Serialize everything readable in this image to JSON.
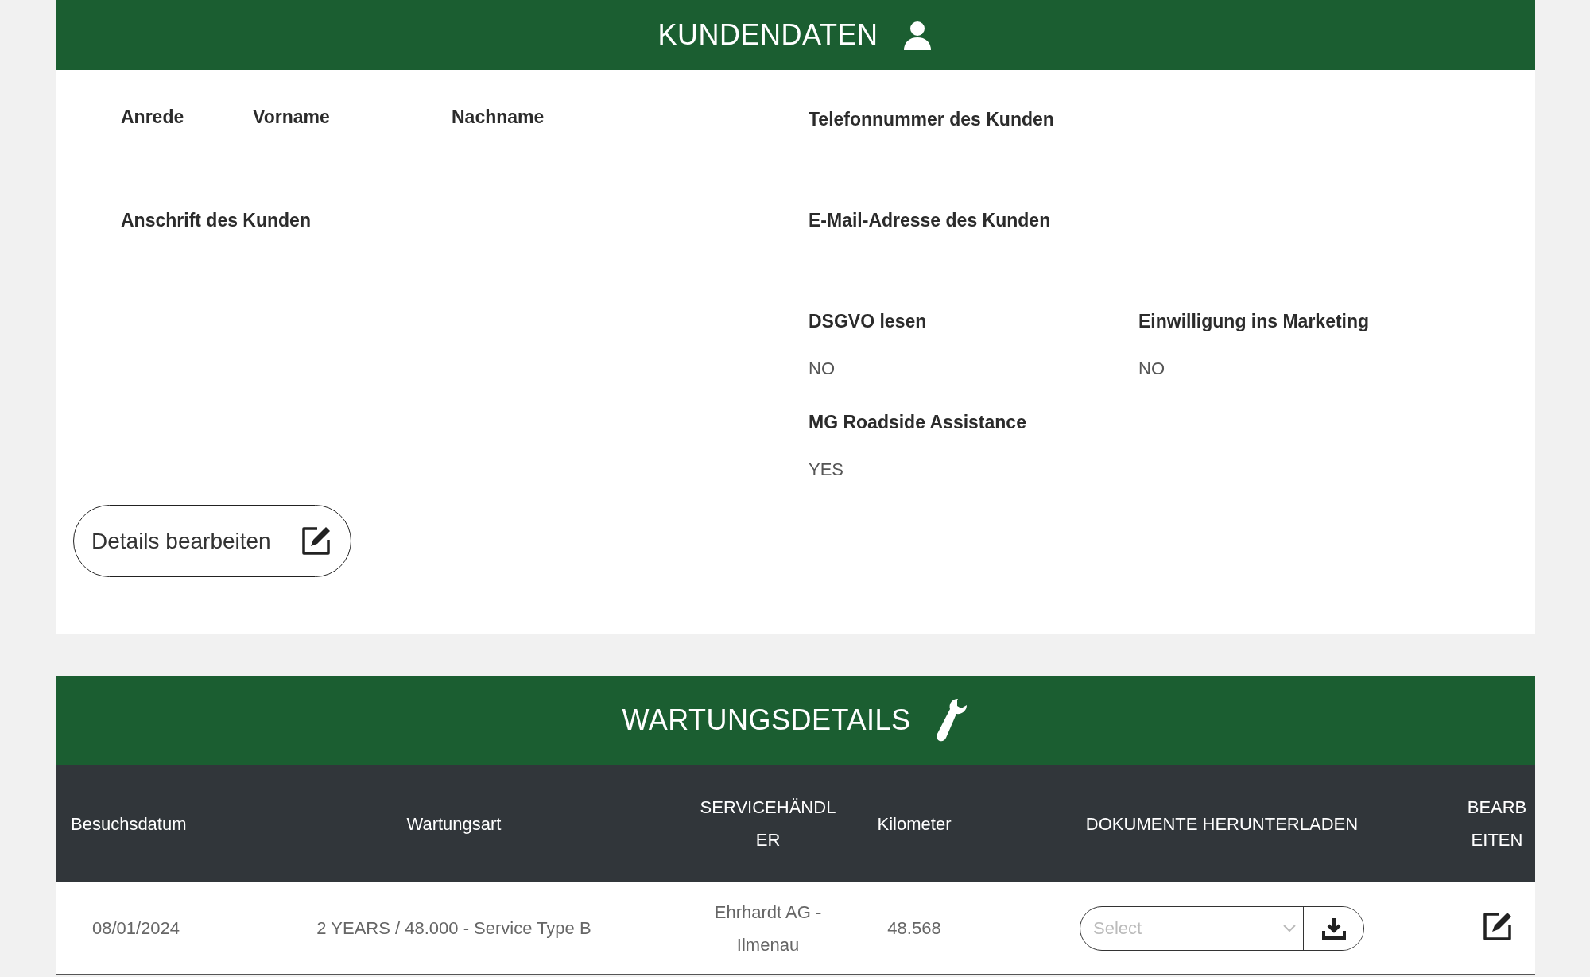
{
  "customer_section": {
    "title": "KUNDENDATEN",
    "name_fields": [
      "Anrede",
      "Vorname",
      "Nachname"
    ],
    "phone": {
      "label": "Telefonnummer des Kunden"
    },
    "address": {
      "label": "Anschrift des Kunden"
    },
    "email": {
      "label": "E-Mail-Adresse des Kunden"
    },
    "flags": [
      {
        "label": "DSGVO lesen",
        "value": "NO"
      },
      {
        "label": "Einwilligung ins Marketing",
        "value": "NO"
      },
      {
        "label": "MG Roadside Assistance",
        "value": "YES"
      }
    ],
    "edit_button": "Details bearbeiten"
  },
  "maintenance_section": {
    "title": "WARTUNGSDETAILS",
    "table": {
      "columns": [
        "Besuchsdatum",
        "Wartungsart",
        "SERVICEHÄNDLER",
        "Kilometer",
        "DOKUMENTE HERUNTERLADEN",
        "BEARBEITEN"
      ],
      "rows": [
        {
          "cells": [
            "08/01/2024",
            "2 YEARS / 48.000 - Service Type B",
            "Ehrhardt AG - Ilmenau",
            "48.568"
          ],
          "document_select": {
            "placeholder": "Select"
          }
        }
      ]
    }
  }
}
